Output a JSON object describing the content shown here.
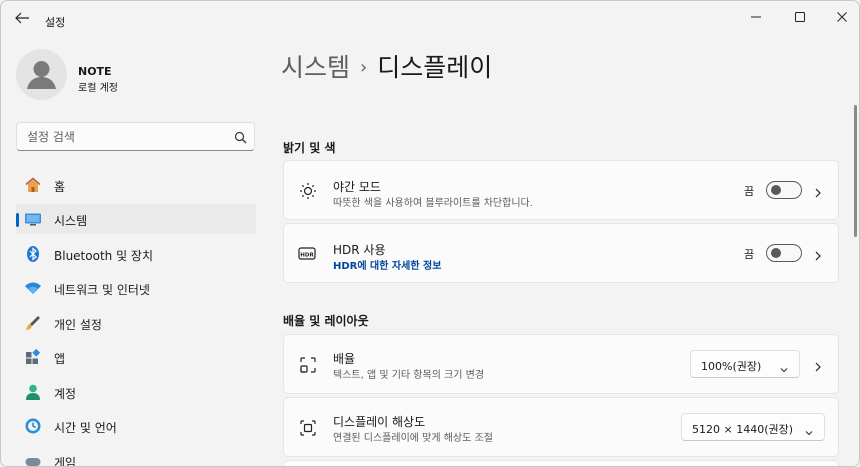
{
  "window": {
    "title": "설정"
  },
  "user": {
    "name": "NOTE",
    "account_type": "로컬 계정"
  },
  "search": {
    "placeholder": "설정 검색",
    "value": ""
  },
  "sidebar": {
    "items": [
      {
        "label": "홈",
        "icon": "home-icon"
      },
      {
        "label": "시스템",
        "icon": "system-icon",
        "active": true
      },
      {
        "label": "Bluetooth 및 장치",
        "icon": "bluetooth-icon"
      },
      {
        "label": "네트워크 및 인터넷",
        "icon": "network-icon"
      },
      {
        "label": "개인 설정",
        "icon": "personalization-icon"
      },
      {
        "label": "앱",
        "icon": "apps-icon"
      },
      {
        "label": "계정",
        "icon": "accounts-icon"
      },
      {
        "label": "시간 및 언어",
        "icon": "time-language-icon"
      },
      {
        "label": "게임",
        "icon": "gaming-icon"
      }
    ]
  },
  "breadcrumb": {
    "parent": "시스템",
    "separator": "›",
    "current": "디스플레이"
  },
  "sections": {
    "brightness": {
      "header": "밝기 및 색",
      "night_light": {
        "title": "야간 모드",
        "subtitle": "따뜻한 색을 사용하여 블루라이트를 차단합니다.",
        "state": "끔",
        "icon": "night-light-icon"
      },
      "hdr": {
        "title": "HDR 사용",
        "link": "HDR에 대한 자세한 정보",
        "state": "끔",
        "icon": "hdr-icon",
        "badge": "HDR"
      }
    },
    "scale_layout": {
      "header": "배율 및 레이아웃",
      "scale": {
        "title": "배율",
        "subtitle": "텍스트, 앱 및 기타 항목의 크기 변경",
        "value": "100%(권장)",
        "icon": "scale-icon"
      },
      "resolution": {
        "title": "디스플레이 해상도",
        "subtitle": "연결된 디스플레이에 맞게 해상도 조절",
        "value": "5120 × 1440(권장)",
        "icon": "resolution-icon"
      }
    }
  },
  "colors": {
    "accent": "#0067c0",
    "link": "#0046a0"
  }
}
